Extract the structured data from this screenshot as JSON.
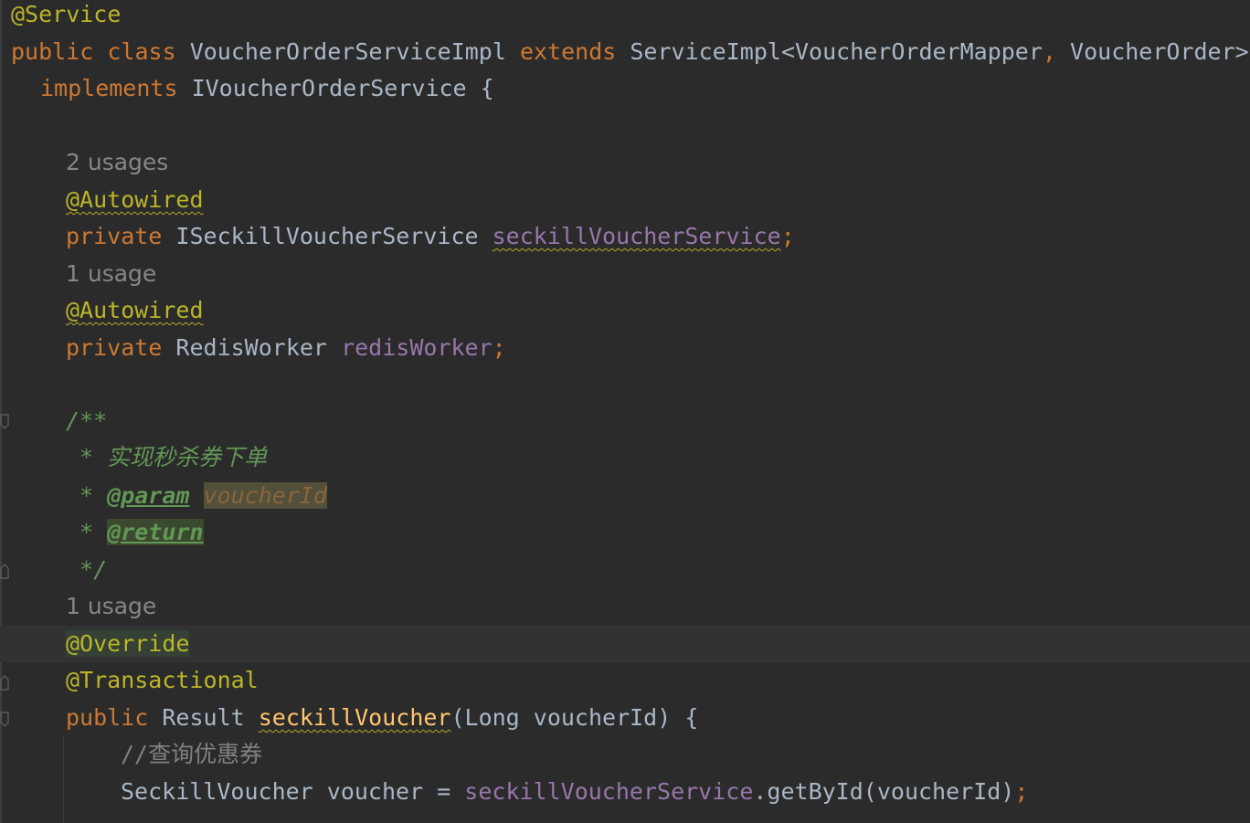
{
  "code": {
    "lines": {
      "service_annotation": "@Service",
      "class_public": "public",
      "class_kw": "class",
      "class_name": "VoucherOrderServiceImpl",
      "extends_kw": "extends",
      "super_class": "ServiceImpl<VoucherOrderMapper",
      "comma": ",",
      "super_generic2": "VoucherOrder>",
      "implements_kw": "implements",
      "interface_name": "IVoucherOrderService {",
      "usages_hint_1": "2 usages",
      "autowired_1": "@Autowired",
      "private_1": "private",
      "type_1": "ISeckillVoucherService",
      "field_1": "seckillVoucherService",
      "semicolon_1": ";",
      "usages_hint_2": "1 usage",
      "autowired_2": "@Autowired",
      "private_2": "private",
      "type_2": "RedisWorker",
      "field_2": "redisWorker",
      "semicolon_2": ";",
      "javadoc_open": "/**",
      "javadoc_desc": " * 实现秒杀券下单",
      "javadoc_star_1": " * ",
      "javadoc_param_tag": "@param",
      "javadoc_param_name": "voucherId",
      "javadoc_star_2": " * ",
      "javadoc_return_tag": "@return",
      "javadoc_close": " */",
      "usages_hint_3": "1 usage",
      "override": "@Override",
      "transactional": "@Transactional",
      "method_public": "public",
      "method_return_type": "Result",
      "method_name": "seckillVoucher",
      "method_params": "(Long voucherId) {",
      "line_comment": "//查询优惠券",
      "stmt_type": "SeckillVoucher voucher = ",
      "stmt_field": "seckillVoucherService",
      "stmt_call": ".getById(voucherId)",
      "stmt_semicolon": ";"
    }
  }
}
